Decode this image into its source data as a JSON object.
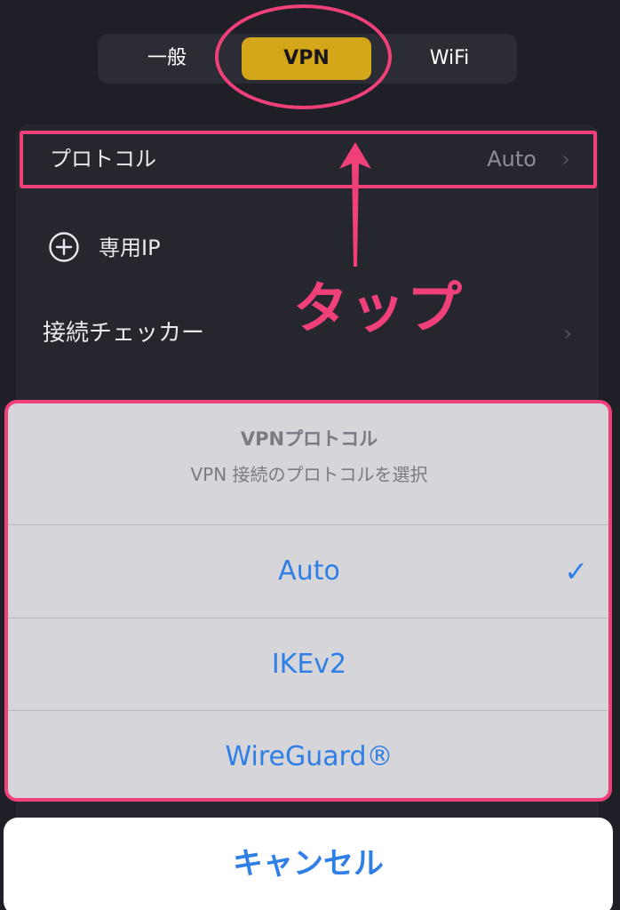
{
  "tabs": [
    {
      "label": "一般",
      "selected": false
    },
    {
      "label": "VPN",
      "selected": true
    },
    {
      "label": "WiFi",
      "selected": false
    }
  ],
  "settings": {
    "protocol": {
      "label": "プロトコル",
      "value": "Auto",
      "chevron": "›"
    },
    "dedicated_ip": {
      "label": "専用IP",
      "icon": "plus-circle-icon"
    },
    "connection_checker": {
      "label": "接続チェッカー",
      "chevron": "›"
    }
  },
  "annotation": {
    "tap_text": "タップ",
    "color": "#f0407a"
  },
  "action_sheet": {
    "title": "VPNプロトコル",
    "subtitle": "VPN 接続のプロトコルを選択",
    "options": [
      {
        "label": "Auto",
        "selected": true
      },
      {
        "label": "IKEv2",
        "selected": false
      },
      {
        "label": "WireGuard®",
        "selected": false
      }
    ],
    "check_mark": "✓"
  },
  "cancel_label": "キャンセル",
  "colors": {
    "background": "#1f1f27",
    "accent_gold": "#d4a61a",
    "ios_blue": "#2f7fe6",
    "sheet_bg": "#d5d5da"
  }
}
